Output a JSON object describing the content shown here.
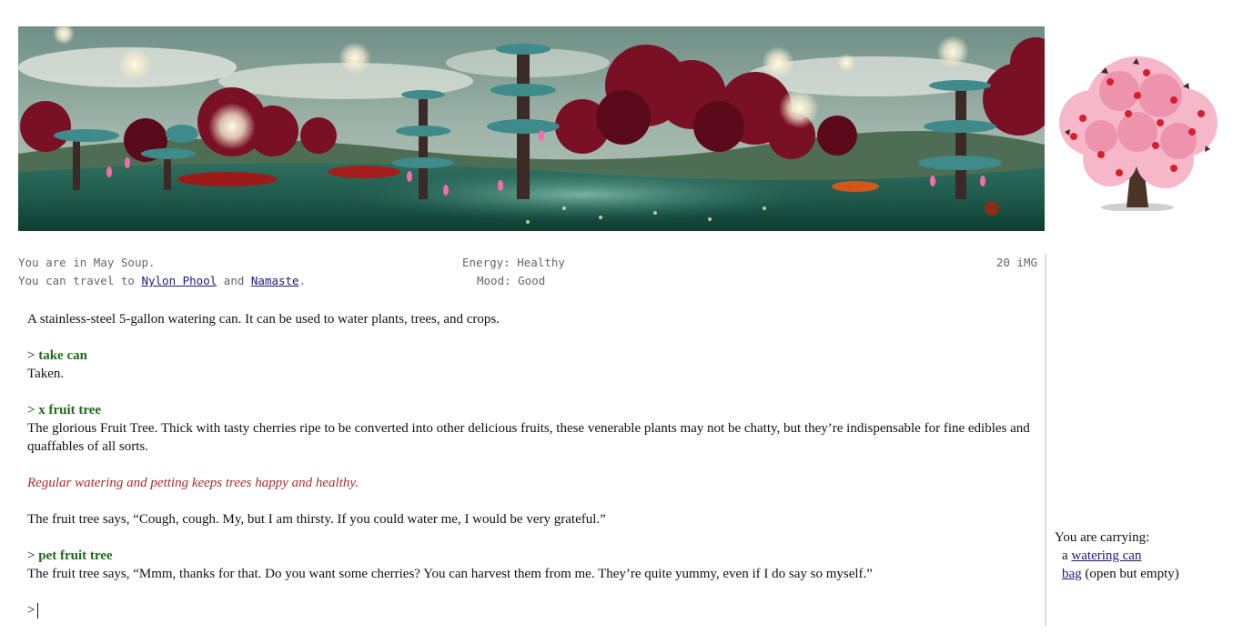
{
  "status": {
    "location_prefix": "You are in ",
    "location": "May Soup",
    "location_suffix": ".",
    "travel_prefix": "You can travel to ",
    "exits": [
      "Nylon Phool",
      "Namaste"
    ],
    "travel_and": " and ",
    "travel_suffix": ".",
    "energy_label": "Energy: ",
    "energy": "Healthy",
    "mood_label": "Mood: ",
    "mood": "Good",
    "money": "20 iMG"
  },
  "transcript": {
    "intro": "A stainless-steel 5-gallon watering can. It can be used to water plants, trees, and crops.",
    "entries": [
      {
        "prompt": "> ",
        "command": "take can",
        "response": "Taken."
      },
      {
        "prompt": "> ",
        "command": "x fruit tree",
        "response": "The glorious Fruit Tree. Thick with tasty cherries ripe to be converted into other delicious fruits, these venerable plants may not be chatty, but they’re indispensable for fine edibles and quaffables of all sorts."
      },
      {
        "prompt": "> ",
        "command": "pet fruit tree",
        "response": "The fruit tree says, “Mmm, thanks for that. Do you want some cherries? You can harvest them from me. They’re quite yummy, even if I do say so myself.”"
      }
    ],
    "hint": "Regular watering and petting keeps trees happy and healthy.",
    "tree_says": "The fruit tree says, “Cough, cough. My, but I am thirsty. If you could water me, I would be very grateful.”",
    "input_prompt": ">"
  },
  "inventory": {
    "heading": "You are carrying:",
    "item1_prefix": "a ",
    "item1_link": "watering can",
    "item2_link": "bag",
    "item2_suffix": " (open but empty)"
  },
  "colors": {
    "command": "#1f6b17",
    "hint": "#b0282e",
    "link": "#1a1a7a",
    "status_text": "#666666"
  },
  "icons": {
    "banner": "forest-landscape-image",
    "portrait": "cherry-tree-image"
  }
}
